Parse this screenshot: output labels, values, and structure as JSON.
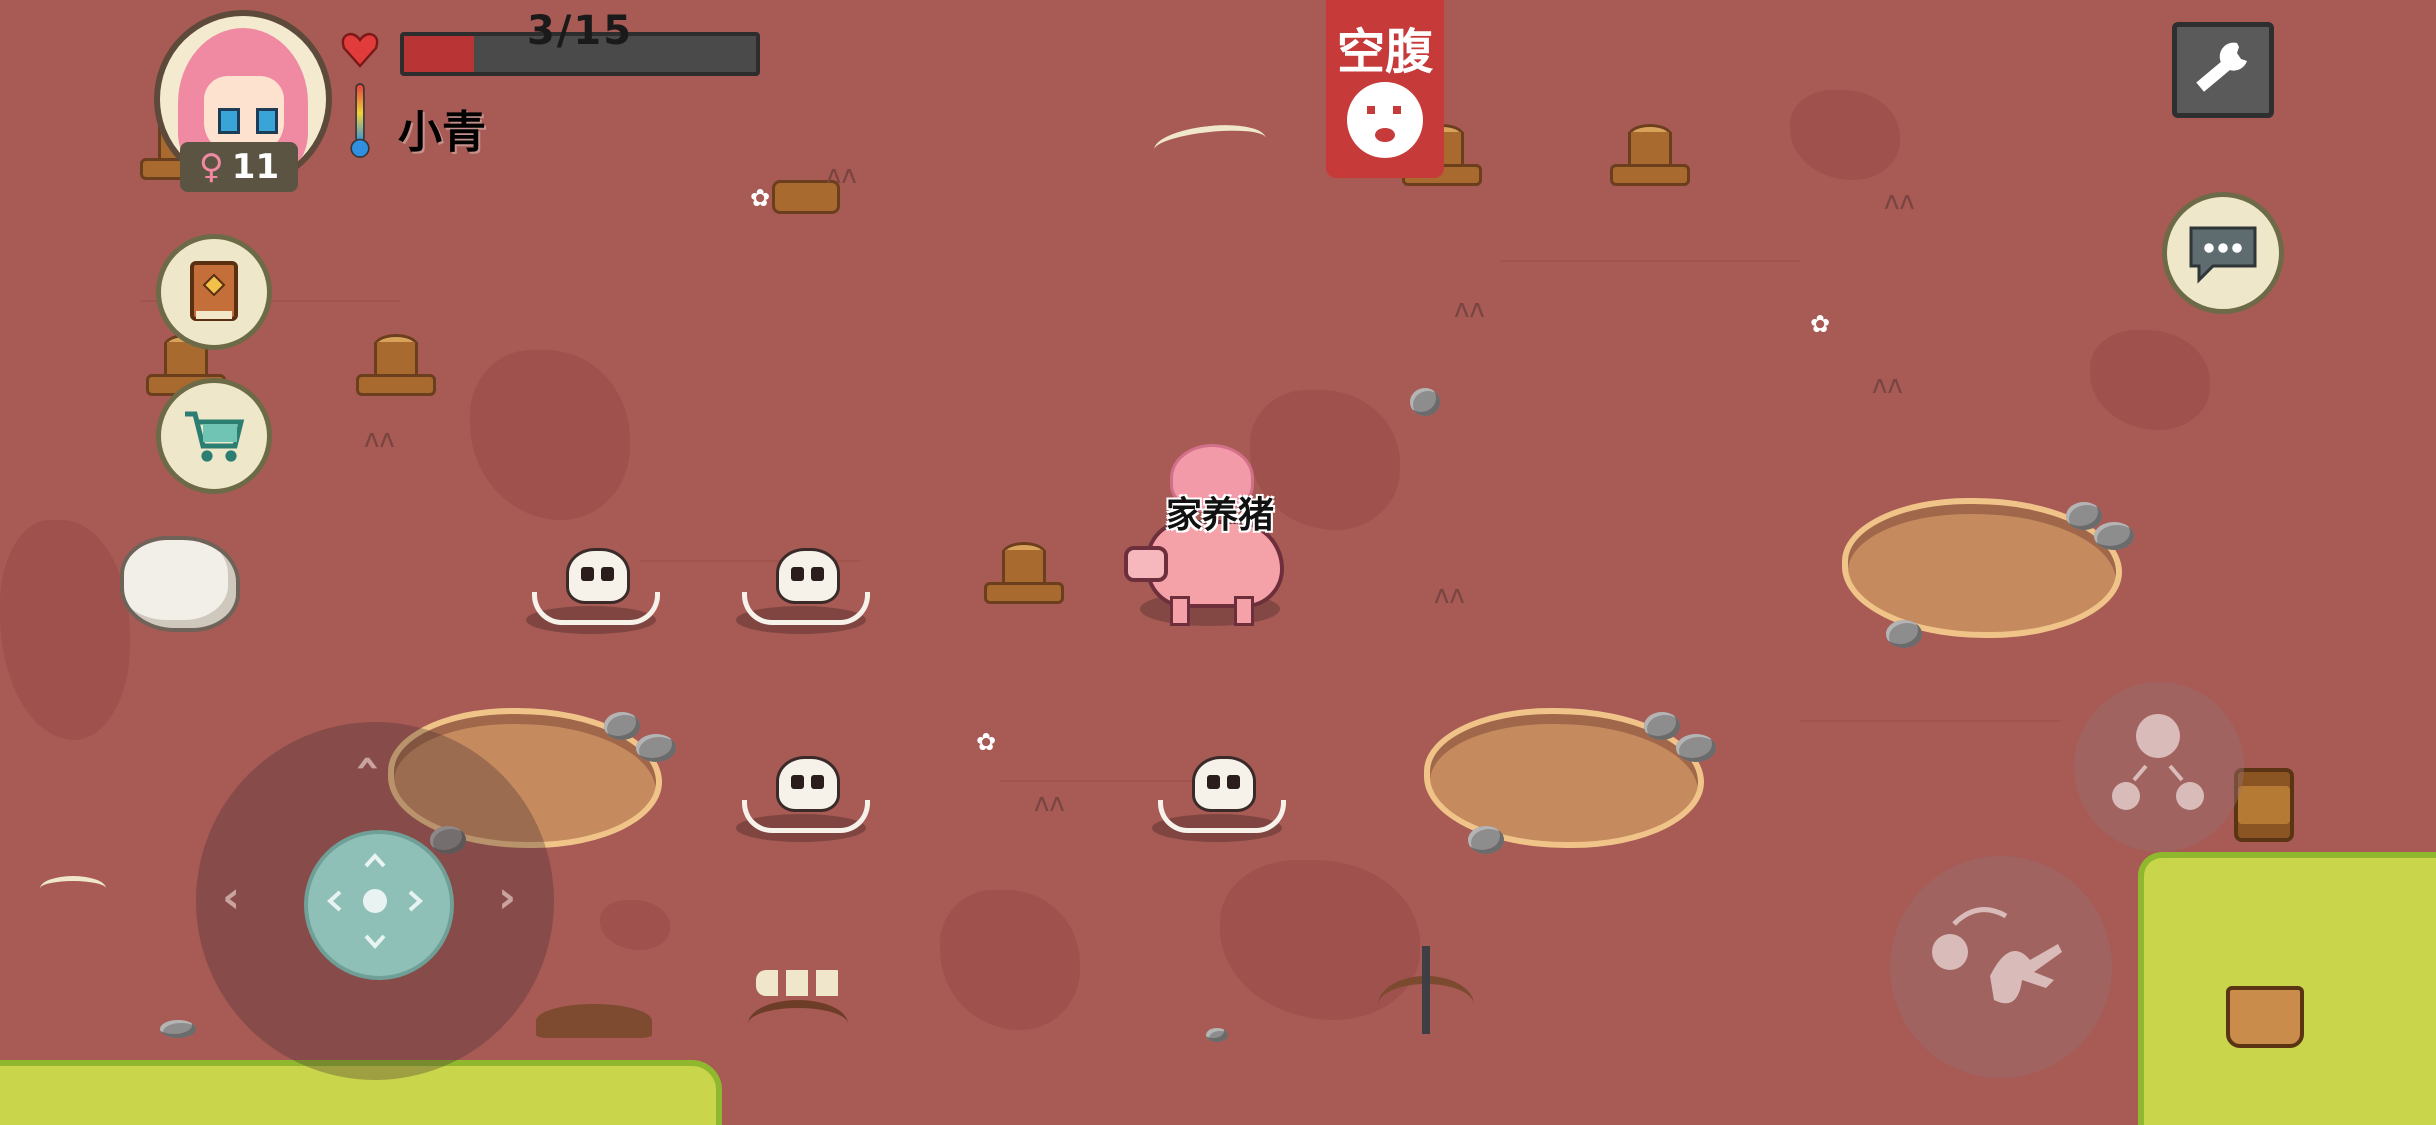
{
  "player": {
    "name": "小青",
    "gender_symbol": "♀",
    "level": "11",
    "health_text": "3/15",
    "health_fraction": 0.2
  },
  "status": {
    "hunger_label": "空腹"
  },
  "entities": {
    "pig_label": "家养猪"
  },
  "icons": {
    "heart": "heart-icon",
    "thermometer": "thermometer-icon",
    "wrench": "wrench-icon",
    "chat": "chat-bubble-icon",
    "recipe_book": "book-icon",
    "shop": "shopping-cart-icon",
    "joystick": "joystick-icon",
    "interact": "grab-hand-icon",
    "split": "split-icon"
  },
  "colors": {
    "ground": "#a85a55",
    "grass": "#c9d54a",
    "health_fill": "#b93535",
    "hunger_banner": "#c73a3a",
    "portrait_hair": "#f08aa3"
  }
}
